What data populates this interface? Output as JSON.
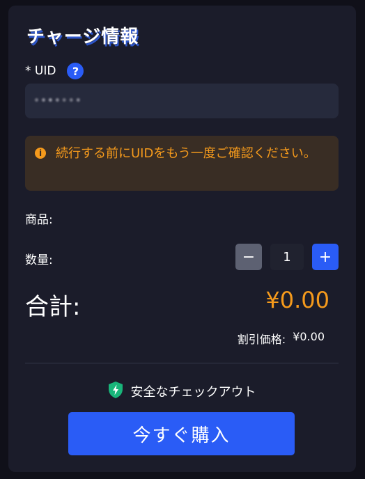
{
  "header": {
    "title": "チャージ情報"
  },
  "uid": {
    "label": "* UID",
    "help_icon": "?",
    "value": "•••••••",
    "value_note": "blurred"
  },
  "notice": {
    "icon": "i",
    "text": "続行する前にUIDをもう一度ご確認ください。",
    "color": "#f59a1c",
    "background": "#392d24"
  },
  "product": {
    "label": "商品:",
    "value": ""
  },
  "quantity": {
    "label": "数量:",
    "minus": "−",
    "value": "1",
    "plus": "+"
  },
  "total": {
    "label": "合計:",
    "value": "¥0.00"
  },
  "discount": {
    "label": "割引価格:",
    "value": "¥0.00"
  },
  "secure": {
    "icon": "shield-lightning-icon",
    "text": "安全なチェックアウト"
  },
  "buy_button": {
    "label": "今すぐ購入"
  },
  "colors": {
    "accent": "#2a5cf6",
    "price": "#f59a1c",
    "secure_icon": "#19b57a"
  }
}
